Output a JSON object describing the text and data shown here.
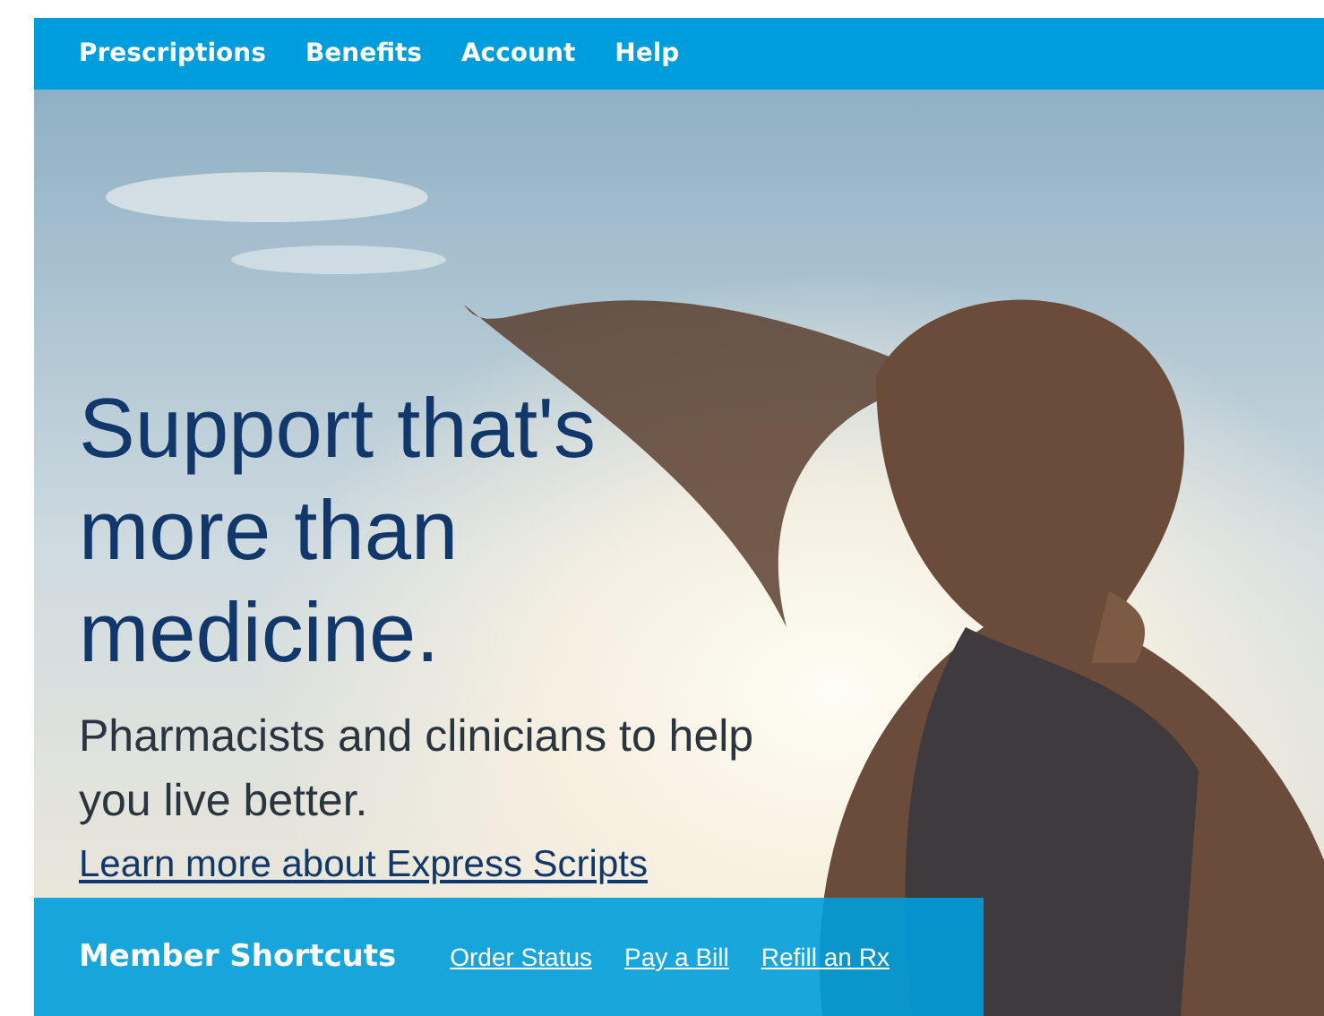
{
  "nav": {
    "items": [
      {
        "label": "Prescriptions"
      },
      {
        "label": "Benefits"
      },
      {
        "label": "Account"
      },
      {
        "label": "Help"
      }
    ]
  },
  "hero": {
    "kind": "picture",
    "headline": "Support that's more than medicine.",
    "subtitle": "Pharmacists and clinicians to help you live better.",
    "link": "Learn more about Express Scripts"
  },
  "shortcuts": {
    "title": "Member Shortcuts",
    "links": [
      {
        "label": "Order Status"
      },
      {
        "label": "Pay a Bill"
      },
      {
        "label": "Refill an Rx"
      }
    ]
  }
}
